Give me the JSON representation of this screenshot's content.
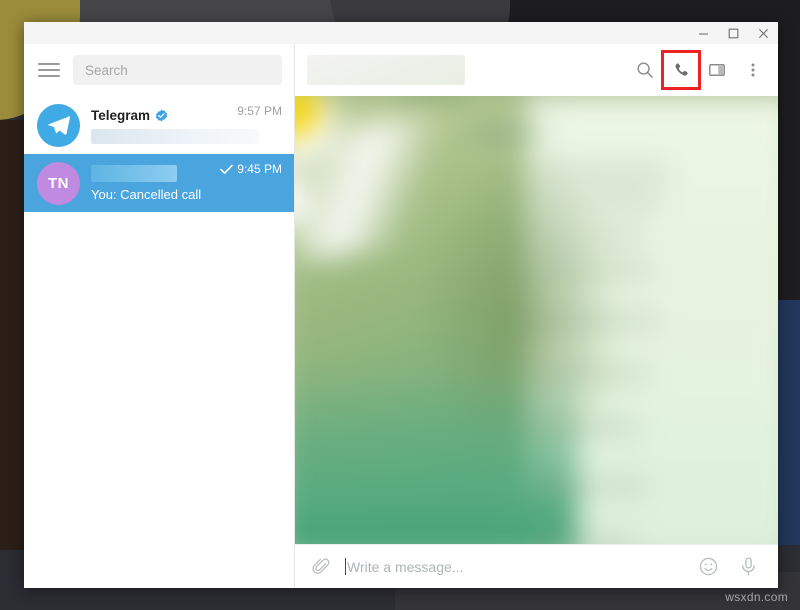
{
  "window": {
    "controls": {
      "minimize_label": "Minimize",
      "maximize_label": "Maximize",
      "close_label": "Close"
    }
  },
  "sidebar": {
    "menu_label": "Menu",
    "search": {
      "placeholder": "Search",
      "value": ""
    },
    "chats": [
      {
        "avatar_text": "",
        "avatar_kind": "telegram-logo",
        "title": "Telegram",
        "verified": true,
        "preview": "",
        "preview_redacted": true,
        "time": "9:57 PM",
        "read_check": false,
        "selected": false
      },
      {
        "avatar_text": "TN",
        "avatar_kind": "initials",
        "title": "",
        "title_redacted": true,
        "verified": false,
        "preview": "You: Cancelled call",
        "preview_redacted": false,
        "time": "9:45 PM",
        "read_check": true,
        "selected": true
      }
    ]
  },
  "chat_header": {
    "title": "",
    "title_redacted": true,
    "actions": [
      {
        "name": "search-icon",
        "label": "Search messages",
        "highlighted": false
      },
      {
        "name": "phone-call-icon",
        "label": "Call",
        "highlighted": true
      },
      {
        "name": "panel-icon",
        "label": "Toggle info panel",
        "highlighted": false
      },
      {
        "name": "more-vertical-icon",
        "label": "More options",
        "highlighted": false
      }
    ],
    "highlight_color": "#ee2222"
  },
  "composer": {
    "attach_label": "Attach file",
    "placeholder": "Write a message...",
    "value": "",
    "emoji_label": "Emoji",
    "voice_label": "Record voice message"
  },
  "watermark": {
    "text": "wsxdn.com"
  },
  "colors": {
    "telegram_blue": "#4aa4dd",
    "avatar_purple": "#c08ae0",
    "highlight_red": "#ee2222",
    "verified_blue": "#3fa2e0"
  }
}
